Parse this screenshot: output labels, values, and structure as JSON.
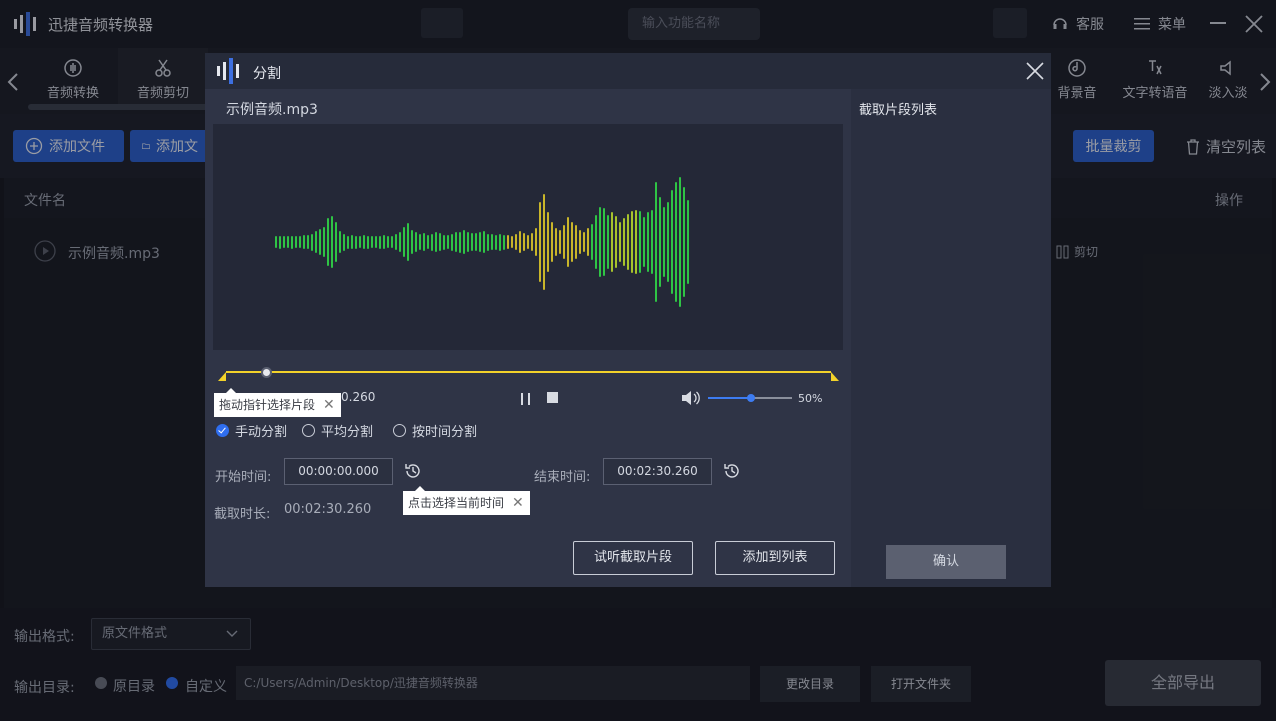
{
  "app": {
    "title": "迅捷音频转换器",
    "search_placeholder": "输入功能名称",
    "service": "客服",
    "menu": "菜单"
  },
  "toolbar": {
    "tools_left": [
      "音频转换",
      "音频剪切"
    ],
    "tools_right": [
      "背景音",
      "文字转语音",
      "淡入淡"
    ]
  },
  "actions": {
    "add_file": "添加文件",
    "add_folder": "添加文",
    "batch_cut": "批量裁剪",
    "clear_list": "清空列表"
  },
  "list": {
    "col_name": "文件名",
    "col_op": "操作",
    "file_name": "示例音频.mp3",
    "cut": "剪切"
  },
  "output": {
    "format_label": "输出格式:",
    "format_value": "原文件格式",
    "dir_label": "输出目录:",
    "opt_original": "原目录",
    "opt_custom": "自定义",
    "path": "C:/Users/Admin/Desktop/迅捷音频转换器",
    "change_dir": "更改目录",
    "open_folder": "打开文件夹",
    "export_all": "全部导出"
  },
  "modal": {
    "title": "分割",
    "file": "示例音频.mp3",
    "tooltip_drag": "拖动指针选择片段",
    "current_time_suffix": "0.260",
    "volume": "50%",
    "volume_level": 0.5,
    "modes": [
      "手动分割",
      "平均分割",
      "按时间分割"
    ],
    "start_label": "开始时间:",
    "start_value": "00:00:00.000",
    "end_label": "结束时间:",
    "end_value": "00:02:30.260",
    "duration_label": "截取时长:",
    "duration_value": "00:02:30.260",
    "tooltip_current": "点击选择当前时间",
    "preview_btn": "试听截取片段",
    "add_btn": "添加到列表",
    "segment_list_title": "截取片段列表",
    "confirm_btn": "确认"
  },
  "colors": {
    "accent_blue": "#2a5fc9",
    "timeline_yellow": "#f2d22a",
    "wave_green": "#2fc445",
    "wave_yellow": "#c9b62a"
  }
}
